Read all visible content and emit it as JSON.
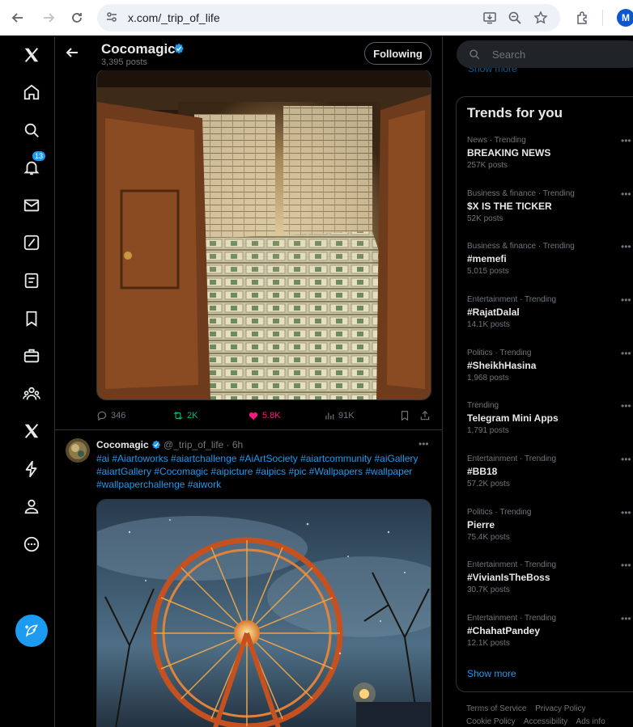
{
  "browser": {
    "url": "x.com/_trip_of_life",
    "profile_initial": "M"
  },
  "nav": {
    "notification_count": "13"
  },
  "header": {
    "name": "Cocomagic",
    "posts_count": "3,395 posts",
    "following_label": "Following"
  },
  "tweet1": {
    "replies": "346",
    "reposts": "2K",
    "likes": "5.8K",
    "views": "91K"
  },
  "tweet2": {
    "name": "Cocomagic",
    "handle_time": "@_trip_of_life · 6h",
    "text": "#ai #Aiartoworks #aiartchallenge #AiArtSociety #aiartcommunity #aiGallery #aiartGallery #Cocomagic #aipicture #aipics #pic #Wallpapers #wallpaper #wallpaperchallenge #aiwork"
  },
  "search": {
    "placeholder": "Search"
  },
  "sidebar": {
    "show_more_top": "Show more",
    "trends_title": "Trends for you",
    "trends": [
      {
        "category": "News · Trending",
        "name": "BREAKING NEWS",
        "posts": "257K posts"
      },
      {
        "category": "Business & finance · Trending",
        "name": "$X IS THE TICKER",
        "posts": "52K posts"
      },
      {
        "category": "Business & finance · Trending",
        "name": "#memefi",
        "posts": "5,015 posts"
      },
      {
        "category": "Entertainment · Trending",
        "name": "#RajatDalal",
        "posts": "14.1K posts"
      },
      {
        "category": "Politics · Trending",
        "name": "#SheikhHasina",
        "posts": "1,968 posts"
      },
      {
        "category": "Trending",
        "name": "Telegram Mini Apps",
        "posts": "1,791 posts"
      },
      {
        "category": "Entertainment · Trending",
        "name": "#BB18",
        "posts": "57.2K posts"
      },
      {
        "category": "Politics · Trending",
        "name": "Pierre",
        "posts": "75.4K posts"
      },
      {
        "category": "Entertainment · Trending",
        "name": "#VivianIsTheBoss",
        "posts": "30.7K posts"
      },
      {
        "category": "Entertainment · Trending",
        "name": "#ChahatPandey",
        "posts": "12.1K posts"
      }
    ],
    "show_more": "Show more"
  },
  "footer": {
    "links": [
      "Terms of Service",
      "Privacy Policy",
      "Cookie Policy",
      "Accessibility",
      "Ads info"
    ]
  }
}
